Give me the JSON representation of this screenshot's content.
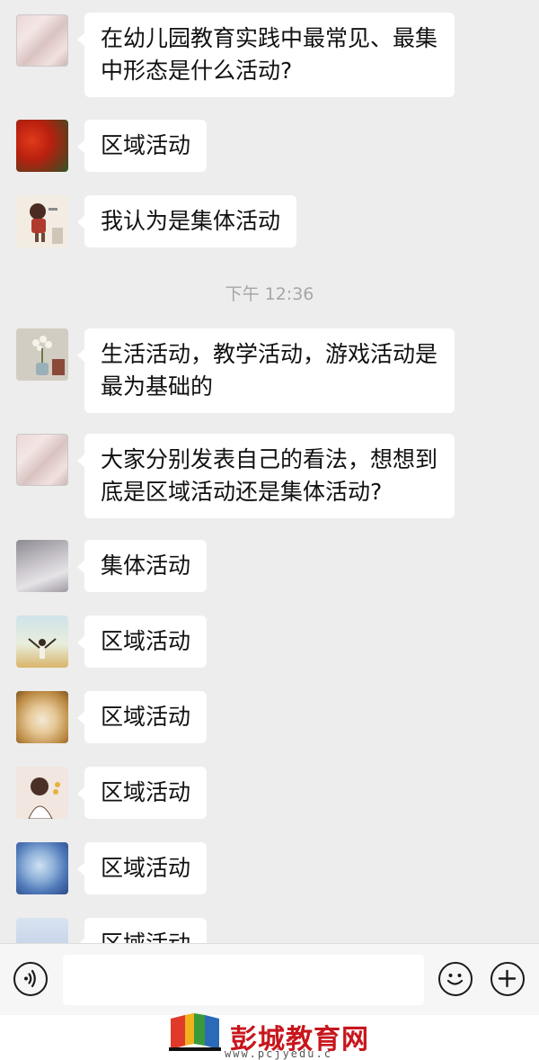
{
  "messages": [
    {
      "text": "在幼儿园教育实践中最常见、最集中形态是什么活动?"
    },
    {
      "text": "区域活动"
    },
    {
      "text": "我认为是集体活动"
    },
    {
      "text": "生活活动，教学活动，游戏活动是最为基础的"
    },
    {
      "text": "大家分别发表自己的看法，想想到底是区域活动还是集体活动?"
    },
    {
      "text": "集体活动"
    },
    {
      "text": "区域活动"
    },
    {
      "text": "区域活动"
    },
    {
      "text": "区域活动"
    },
    {
      "text": "区域活动"
    },
    {
      "text": "区域活动"
    }
  ],
  "timestamp": "下午 12:36",
  "footer": {
    "brand": "彭城教育网",
    "url": "www.pcjyedu.c"
  },
  "colors": {
    "background": "#ededed",
    "bubble": "#ffffff",
    "brand": "#c8161d"
  },
  "icons": [
    "voice-icon",
    "emoji-icon",
    "plus-icon"
  ]
}
